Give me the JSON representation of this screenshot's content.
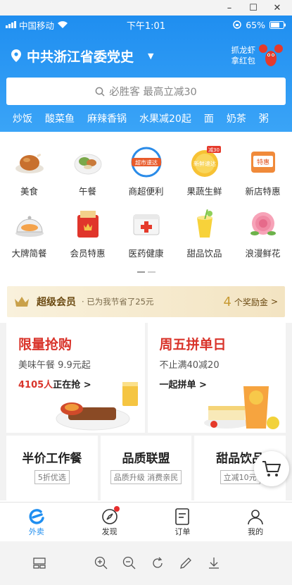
{
  "window": {
    "minimize": "–",
    "maximize": "☐",
    "close": "✕"
  },
  "status": {
    "carrier": "中国移动",
    "time": "下午1:01",
    "battery": "65%"
  },
  "location": {
    "title": "中共浙江省委党史"
  },
  "promo": {
    "line1": "抓龙虾",
    "line2": "拿红包"
  },
  "search": {
    "placeholder": "必胜客 最高立减30"
  },
  "quick_links": [
    "炒饭",
    "酸菜鱼",
    "麻辣香锅",
    "水果减20起",
    "面",
    "奶茶",
    "粥"
  ],
  "categories": [
    {
      "label": "美食",
      "icon": "roast-chicken-icon"
    },
    {
      "label": "午餐",
      "icon": "bowl-icon"
    },
    {
      "label": "商超便利",
      "icon": "supermarket-icon",
      "badge": "超市速达"
    },
    {
      "label": "果蔬生鲜",
      "icon": "fresh-icon",
      "badge": "新鲜速达",
      "corner": "减30"
    },
    {
      "label": "新店特惠",
      "icon": "new-store-icon",
      "badge": "特惠"
    },
    {
      "label": "大牌简餐",
      "icon": "cloche-icon"
    },
    {
      "label": "会员特惠",
      "icon": "vip-bag-icon"
    },
    {
      "label": "医药健康",
      "icon": "medicine-box-icon"
    },
    {
      "label": "甜品饮品",
      "icon": "drink-icon"
    },
    {
      "label": "浪漫鲜花",
      "icon": "rose-icon"
    }
  ],
  "vip": {
    "title": "超级会员",
    "subtitle": "· 已为我节省了25元",
    "count": "4",
    "count_suffix": "个奖励金",
    "chevron": ">"
  },
  "deals": [
    {
      "title": "限量抢购",
      "subtitle": "美味午餐 9.9元起",
      "cta_highlight": "4105人",
      "cta": "正在抢 >"
    },
    {
      "title": "周五拼单日",
      "subtitle": "不止满40减20",
      "cta_highlight": "",
      "cta": "一起拼单 >"
    }
  ],
  "features": [
    {
      "title": "半价工作餐",
      "tag": "5折优选"
    },
    {
      "title": "品质联盟",
      "tag": "品质升级 消费亲民"
    },
    {
      "title": "甜品饮品",
      "tag": "立减10元"
    }
  ],
  "tabs": [
    {
      "label": "外卖",
      "icon": "waimai-icon"
    },
    {
      "label": "发现",
      "icon": "compass-icon"
    },
    {
      "label": "订单",
      "icon": "order-icon"
    },
    {
      "label": "我的",
      "icon": "profile-icon"
    }
  ],
  "colors": {
    "brand": "#1f8ef0",
    "accent": "#d9342b",
    "vip": "#6b4a12"
  }
}
